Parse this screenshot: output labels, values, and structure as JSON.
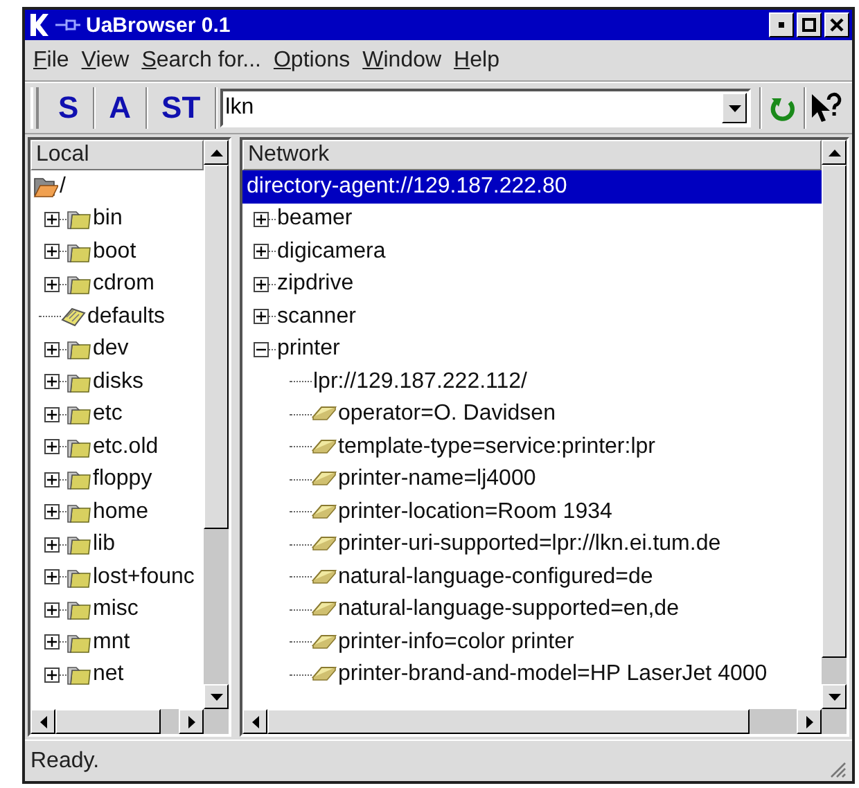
{
  "window": {
    "title": "UaBrowser 0.1"
  },
  "menu": [
    "File",
    "View",
    "Search for...",
    "Options",
    "Window",
    "Help"
  ],
  "toolbar": {
    "buttons": [
      "S",
      "A",
      "ST"
    ],
    "search": {
      "value": "lkn"
    }
  },
  "local": {
    "header": "Local",
    "tree": [
      {
        "label": "/",
        "kind": "folder",
        "expanded": true,
        "children": [
          {
            "label": "bin",
            "kind": "folder",
            "expanded": false
          },
          {
            "label": "boot",
            "kind": "folder",
            "expanded": false
          },
          {
            "label": "cdrom",
            "kind": "folder",
            "expanded": false
          },
          {
            "label": "defaults",
            "kind": "file"
          },
          {
            "label": "dev",
            "kind": "folder",
            "expanded": false
          },
          {
            "label": "disks",
            "kind": "folder",
            "expanded": false
          },
          {
            "label": "etc",
            "kind": "folder",
            "expanded": false
          },
          {
            "label": "etc.old",
            "kind": "folder",
            "expanded": false
          },
          {
            "label": "floppy",
            "kind": "folder",
            "expanded": false
          },
          {
            "label": "home",
            "kind": "folder",
            "expanded": false
          },
          {
            "label": "lib",
            "kind": "folder",
            "expanded": false
          },
          {
            "label": "lost+founc",
            "kind": "folder",
            "expanded": false
          },
          {
            "label": "misc",
            "kind": "folder",
            "expanded": false
          },
          {
            "label": "mnt",
            "kind": "folder",
            "expanded": false
          },
          {
            "label": "net",
            "kind": "folder",
            "expanded": false
          }
        ]
      }
    ]
  },
  "network": {
    "header": "Network",
    "tree": [
      {
        "label": "directory-agent://129.187.222.80",
        "selected": true,
        "children": [
          {
            "label": "beamer",
            "selected": false,
            "expanded": false
          },
          {
            "label": "digicamera",
            "selected": false,
            "expanded": false
          },
          {
            "label": "zipdrive",
            "selected": false,
            "expanded": false
          },
          {
            "label": "scanner",
            "selected": false,
            "expanded": false
          },
          {
            "label": "printer",
            "selected": false,
            "expanded": true,
            "children": [
              {
                "label": "lpr://129.187.222.112/",
                "kind": "url",
                "selected": false
              },
              {
                "label": "operator=O. Davidsen",
                "kind": "attribute",
                "selected": false
              },
              {
                "label": "template-type=service:printer:lpr",
                "kind": "attribute",
                "selected": false
              },
              {
                "label": "printer-name=lj4000",
                "kind": "attribute",
                "selected": false
              },
              {
                "label": "printer-location=Room 1934",
                "kind": "attribute",
                "selected": false
              },
              {
                "label": "printer-uri-supported=lpr://lkn.ei.tum.de",
                "kind": "attribute",
                "selected": false
              },
              {
                "label": "natural-language-configured=de",
                "kind": "attribute",
                "selected": false
              },
              {
                "label": "natural-language-supported=en,de",
                "kind": "attribute",
                "selected": false
              },
              {
                "label": "printer-info=color printer",
                "kind": "attribute",
                "selected": false
              },
              {
                "label": "printer-brand-and-model=HP LaserJet 4000",
                "kind": "attribute",
                "selected": false
              }
            ]
          }
        ]
      }
    ]
  },
  "status_bar": "Ready."
}
